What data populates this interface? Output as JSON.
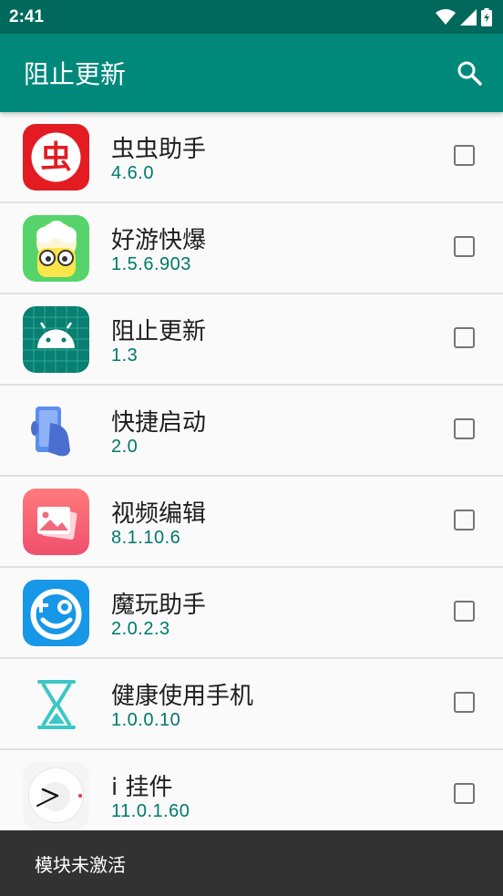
{
  "status_bar": {
    "time": "2:41",
    "icons": [
      "wifi-icon",
      "signal-icon",
      "battery-icon"
    ]
  },
  "app_bar": {
    "title": "阻止更新",
    "search_icon": "search-icon",
    "color": "#00897b"
  },
  "apps": [
    {
      "name": "虫虫助手",
      "version": "4.6.0",
      "checked": false,
      "icon": "chongchong-icon"
    },
    {
      "name": "好游快爆",
      "version": "1.5.6.903",
      "checked": false,
      "icon": "haoyou-icon"
    },
    {
      "name": "阻止更新",
      "version": "1.3",
      "checked": false,
      "icon": "android-icon"
    },
    {
      "name": "快捷启动",
      "version": "2.0",
      "checked": false,
      "icon": "quick-launch-icon"
    },
    {
      "name": "视频编辑",
      "version": "8.1.10.6",
      "checked": false,
      "icon": "video-edit-icon"
    },
    {
      "name": "魔玩助手",
      "version": "2.0.2.3",
      "checked": false,
      "icon": "mowan-icon"
    },
    {
      "name": "健康使用手机",
      "version": "1.0.0.10",
      "checked": false,
      "icon": "hourglass-icon"
    },
    {
      "name": "i 挂件",
      "version": "11.0.1.60",
      "checked": false,
      "icon": "clock-widget-icon"
    }
  ],
  "snackbar": {
    "message": "模块未激活"
  }
}
